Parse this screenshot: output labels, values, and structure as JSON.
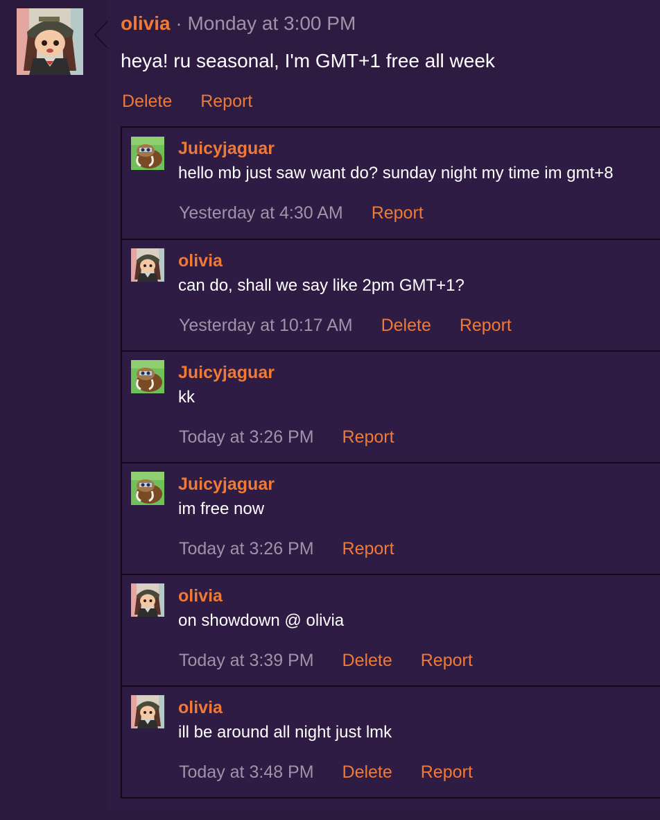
{
  "colors": {
    "page_background": "#2b1a3e",
    "accent": "#ef7a35",
    "muted_text": "#9d94a8",
    "border": "#120a1c"
  },
  "post": {
    "author": "olivia",
    "separator": "·",
    "timestamp": "Monday at 3:00 PM",
    "body": "heya! ru seasonal, I'm GMT+1 free all week",
    "actions": {
      "delete": "Delete",
      "report": "Report"
    }
  },
  "replies": [
    {
      "author": "Juicyjaguar",
      "avatar": "mamoswine-avatar",
      "text": "hello mb just saw want do? sunday night my time im gmt+8",
      "timestamp": "Yesterday at 4:30 AM",
      "report": "Report"
    },
    {
      "author": "olivia",
      "avatar": "olivia-avatar",
      "text": "can do, shall we say like 2pm GMT+1?",
      "timestamp": "Yesterday at 10:17 AM",
      "delete": "Delete",
      "report": "Report"
    },
    {
      "author": "Juicyjaguar",
      "avatar": "mamoswine-avatar",
      "text": "kk",
      "timestamp": "Today at 3:26 PM",
      "report": "Report"
    },
    {
      "author": "Juicyjaguar",
      "avatar": "mamoswine-avatar",
      "text": "im free now",
      "timestamp": "Today at 3:26 PM",
      "report": "Report"
    },
    {
      "author": "olivia",
      "avatar": "olivia-avatar",
      "text": "on showdown @ olivia",
      "timestamp": "Today at 3:39 PM",
      "delete": "Delete",
      "report": "Report"
    },
    {
      "author": "olivia",
      "avatar": "olivia-avatar",
      "text": "ill be around all night just lmk",
      "timestamp": "Today at 3:48 PM",
      "delete": "Delete",
      "report": "Report"
    }
  ]
}
